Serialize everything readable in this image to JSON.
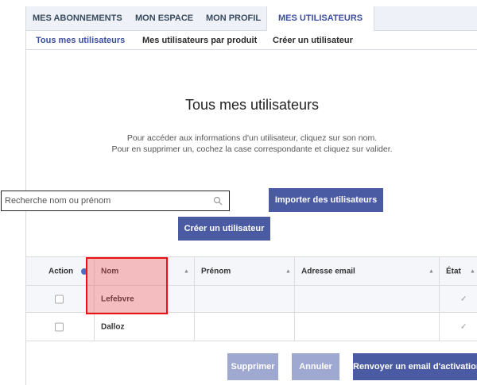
{
  "tabs": [
    {
      "label": "MES ABONNEMENTS"
    },
    {
      "label": "MON ESPACE"
    },
    {
      "label": "MON PROFIL"
    },
    {
      "label": "MES UTILISATEURS",
      "active": true
    }
  ],
  "subnav": [
    {
      "label": "Tous mes utilisateurs",
      "current": true
    },
    {
      "label": "Mes utilisateurs par produit"
    },
    {
      "label": "Créer un utilisateur"
    }
  ],
  "page": {
    "title": "Tous mes utilisateurs",
    "desc1": "Pour accéder aux informations d'un utilisateur, cliquez sur son nom.",
    "desc2": "Pour en supprimer un, cochez la case correspondante et cliquez sur valider."
  },
  "search": {
    "placeholder": "Recherche nom ou prénom",
    "icon": "search-icon"
  },
  "buttons": {
    "import": "Importer des utilisateurs",
    "create": "Créer un utilisateur",
    "delete": "Supprimer",
    "cancel": "Annuler",
    "resend": "Renvoyer un email d'activation"
  },
  "table": {
    "columns": [
      "Action",
      "Nom",
      "Prénom",
      "Adresse email",
      "État"
    ],
    "rows": [
      {
        "nom": "Lefebvre",
        "prenom": "",
        "email": "",
        "etat": "✓"
      },
      {
        "nom": "Dalloz",
        "prenom": "",
        "email": "",
        "etat": "✓"
      }
    ]
  },
  "colors": {
    "accent": "#4a5ba3",
    "accent_disabled": "#9ea8d1",
    "highlight": "#e11111"
  }
}
